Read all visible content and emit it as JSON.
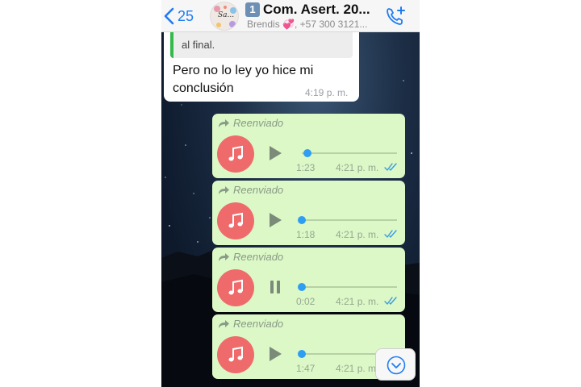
{
  "header": {
    "back_count": "25",
    "group_number": "1",
    "title": "Com. Asert. 20...",
    "subtitle": "Brendis 💞, +57 300 3121...",
    "avatar_text": "Sa..."
  },
  "quoted_message": {
    "quote_text": "al final.",
    "text": "Pero no lo ley yo hice mi conclusión",
    "time": "4:19 p. m."
  },
  "voice_messages": [
    {
      "forward_label": "Reenviado",
      "duration": "1:23",
      "time": "4:21 p. m.",
      "state": "play",
      "progress": 0.06
    },
    {
      "forward_label": "Reenviado",
      "duration": "1:18",
      "time": "4:21 p. m.",
      "state": "play",
      "progress": 0.0
    },
    {
      "forward_label": "Reenviado",
      "duration": "0:02",
      "time": "4:21 p. m.",
      "state": "pause",
      "progress": 0.0
    },
    {
      "forward_label": "Reenviado",
      "duration": "1:47",
      "time": "4:21 p. m.",
      "state": "play",
      "progress": 0.0
    }
  ],
  "colors": {
    "accent": "#1e7cf2",
    "bubble_out": "#dcf8c6",
    "music_disc": "#ef6b6b",
    "knob": "#2e9df2",
    "quote_bar": "#35b94a"
  },
  "icons": {
    "back": "chevron-left-icon",
    "call": "add-call-icon",
    "music": "music-note-icon",
    "forward": "forward-arrow-icon",
    "read": "double-check-icon",
    "scroll": "chevron-down-circle-icon"
  }
}
